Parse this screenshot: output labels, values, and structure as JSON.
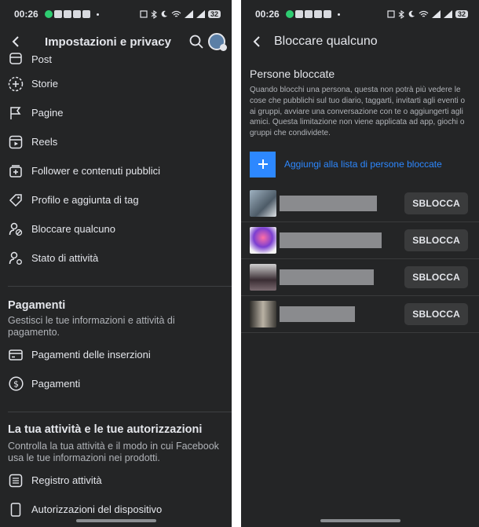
{
  "status_bar": {
    "time": "00:26",
    "battery": "32"
  },
  "left": {
    "title": "Impostazioni e privacy",
    "menu_top": [
      {
        "label": "Post",
        "icon": "calendar-icon"
      },
      {
        "label": "Storie",
        "icon": "story-plus-icon"
      },
      {
        "label": "Pagine",
        "icon": "flag-icon"
      },
      {
        "label": "Reels",
        "icon": "reels-icon"
      },
      {
        "label": "Follower e contenuti pubblici",
        "icon": "public-content-icon"
      },
      {
        "label": "Profilo e aggiunta di tag",
        "icon": "tag-icon"
      },
      {
        "label": "Bloccare qualcuno",
        "icon": "block-user-icon"
      },
      {
        "label": "Stato di attività",
        "icon": "activity-status-icon"
      }
    ],
    "payments": {
      "title": "Pagamenti",
      "subtitle": "Gestisci le tue informazioni e attività di pagamento.",
      "items": [
        {
          "label": "Pagamenti delle inserzioni",
          "icon": "credit-card-icon"
        },
        {
          "label": "Pagamenti",
          "icon": "dollar-icon"
        }
      ]
    },
    "activity": {
      "title": "La tua attività e le tue autorizzazioni",
      "subtitle": "Controlla la tua attività e il modo in cui Facebook usa le tue informazioni nei prodotti.",
      "items": [
        {
          "label": "Registro attività",
          "icon": "activity-log-icon"
        },
        {
          "label": "Autorizzazioni del dispositivo",
          "icon": "device-icon"
        }
      ]
    }
  },
  "right": {
    "title": "Bloccare qualcuno",
    "section_title": "Persone bloccate",
    "description": "Quando blocchi una persona, questa non potrà più vedere le cose che pubblichi sul tuo diario, taggarti, invitarti agli eventi o ai gruppi, avviare una conversazione con te o aggiungerti agli amici. Questa limitazione non viene applicata ad app, giochi o gruppi che condividete.",
    "add_label": "Aggiungi alla lista di persone bloccate",
    "unblock_label": "SBLOCCA",
    "blocked": [
      {
        "thumb_color": "#6d7c8a",
        "name_hidden": true
      },
      {
        "thumb_color": "#c94b7a",
        "name_hidden": true
      },
      {
        "thumb_color": "#5a4e55",
        "name_hidden": true
      },
      {
        "thumb_color": "#4a4742",
        "name_hidden": true
      }
    ]
  },
  "colors": {
    "background": "#242526",
    "accent": "#2d88ff",
    "text": "#e4e6eb",
    "muted": "#b0b3b8"
  }
}
